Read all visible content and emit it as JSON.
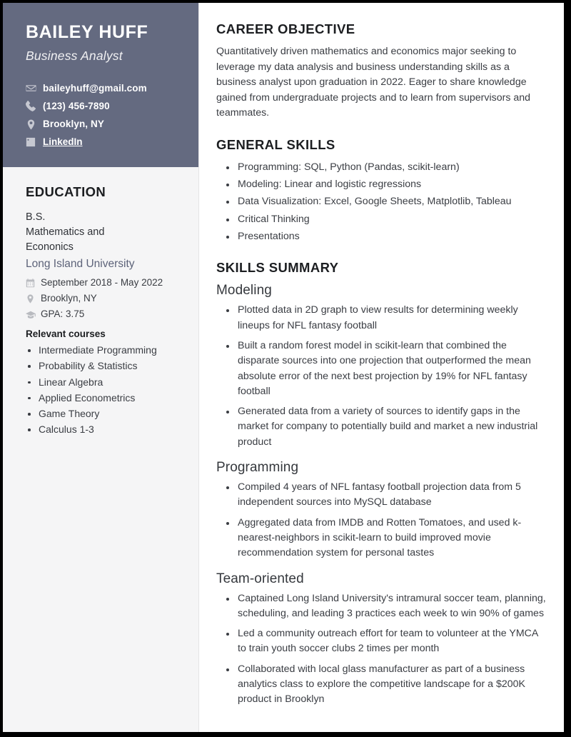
{
  "theme": {
    "sidebar_header_bg": "#646a80",
    "sidebar_bg": "#f5f5f6",
    "page_bg": "#ffffff",
    "heading_color": "#1c1e21",
    "body_text_color": "#3a3d43",
    "accent_color": "#5d6379",
    "border_color": "#000000"
  },
  "sidebar": {
    "full_name": "BAILEY HUFF",
    "job_title": "Business Analyst",
    "contacts": [
      {
        "icon": "envelope-icon",
        "name": "email",
        "text": "baileyhuff@gmail.com",
        "is_link": false
      },
      {
        "icon": "phone-icon",
        "name": "phone",
        "text": "(123) 456-7890",
        "is_link": false
      },
      {
        "icon": "location-pin-icon",
        "name": "location",
        "text": "Brooklyn, NY",
        "is_link": false
      },
      {
        "icon": "linkedin-icon",
        "name": "linkedin",
        "text": "LinkedIn",
        "is_link": true
      }
    ],
    "education": {
      "title": "EDUCATION",
      "degree": "B.S.",
      "major": "Mathematics and Econonics",
      "school": "Long Island University",
      "meta": [
        {
          "icon": "calendar-icon",
          "name": "education-dates",
          "text": "September 2018 - May 2022"
        },
        {
          "icon": "location-pin-icon",
          "name": "education-location",
          "text": "Brooklyn, NY"
        },
        {
          "icon": "graduation-cap-icon",
          "name": "education-gpa",
          "text": "GPA: 3.75"
        }
      ],
      "courses_label": "Relevant courses",
      "courses": [
        "Intermediate Programming",
        "Probability & Statistics",
        "Linear Algebra",
        "Applied Econometrics",
        "Game Theory",
        "Calculus 1-3"
      ]
    }
  },
  "main": {
    "career_objective": {
      "title": "CAREER OBJECTIVE",
      "text": "Quantitatively driven mathematics and economics major seeking to leverage my data analysis and business understanding skills as a business analyst upon graduation in 2022. Eager to share knowledge gained from undergraduate projects and to learn from supervisors and teammates."
    },
    "general_skills": {
      "title": "GENERAL SKILLS",
      "items": [
        "Programming: SQL, Python (Pandas, scikit-learn)",
        "Modeling: Linear and logistic regressions",
        "Data Visualization: Excel, Google Sheets, Matplotlib, Tableau",
        "Critical Thinking",
        "Presentations"
      ]
    },
    "skills_summary": {
      "title": "SKILLS SUMMARY",
      "subsections": [
        {
          "title": "Modeling",
          "items": [
            "Plotted data in 2D graph to view results for determining weekly lineups for NFL fantasy football",
            "Built a random forest model in scikit-learn that combined the disparate sources into one projection that outperformed the mean absolute error of the next best projection by 19% for NFL fantasy football",
            "Generated data from a variety of sources to identify gaps in the market for company to potentially build and market a new industrial product"
          ]
        },
        {
          "title": "Programming",
          "items": [
            "Compiled 4 years of NFL fantasy football projection data from 5 independent sources into MySQL database",
            "Aggregated data from IMDB and Rotten Tomatoes, and used k-nearest-neighbors in scikit-learn to build improved movie recommendation system for personal tastes"
          ]
        },
        {
          "title": "Team-oriented",
          "items": [
            "Captained Long Island University's intramural soccer team, planning, scheduling, and leading 3 practices each week to win 90% of games",
            "Led a community outreach effort for team to volunteer at the YMCA to train youth soccer clubs 2 times per month",
            "Collaborated with local glass manufacturer as part of a business analytics class to explore the competitive landscape for a $200K product in Brooklyn"
          ]
        }
      ]
    }
  }
}
